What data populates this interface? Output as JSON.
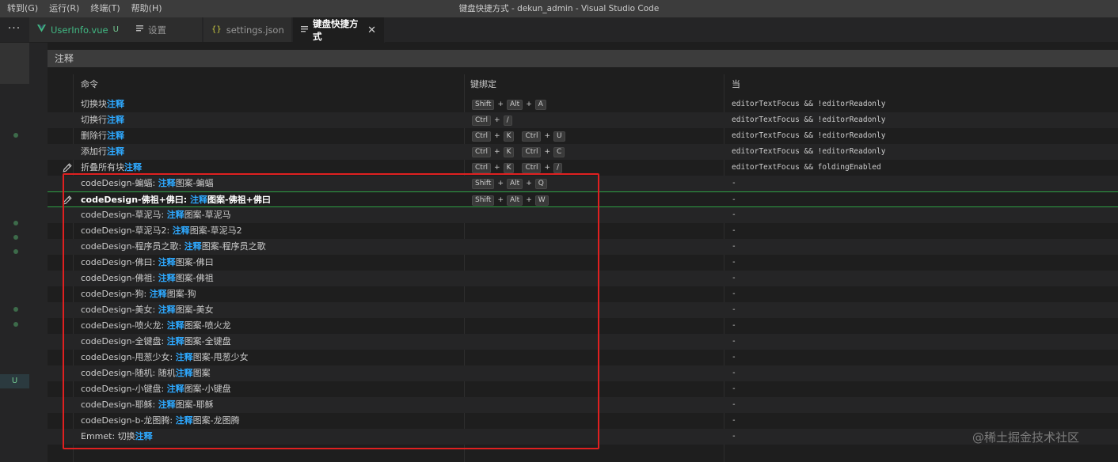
{
  "menu": [
    {
      "label": "转到(G)"
    },
    {
      "label": "运行(R)"
    },
    {
      "label": "终端(T)"
    },
    {
      "label": "帮助(H)"
    }
  ],
  "window_title": "键盘快捷方式 - dekun_admin - Visual Studio Code",
  "tabs": {
    "more": "···",
    "items": [
      {
        "label": "UserInfo.vue",
        "icon": "vue-icon",
        "badge": "U",
        "color": "#41b883"
      },
      {
        "label": "设置",
        "icon": "settings-file-icon"
      },
      {
        "label": "settings.json",
        "icon": "json-braces-icon",
        "icon_text": "{}"
      },
      {
        "label": "键盘快捷方式",
        "icon": "keyboard-file-icon",
        "close": "✕"
      }
    ]
  },
  "gutter": {
    "badge": "U"
  },
  "search": {
    "value": "注释"
  },
  "columns": {
    "command": "命令",
    "keybinding": "键绑定",
    "when": "当"
  },
  "rows": [
    {
      "pre": "切换块",
      "hl": "注释",
      "post": "",
      "keys": [
        [
          "Shift",
          "Alt",
          "A"
        ]
      ],
      "when": "editorTextFocus && !editorReadonly"
    },
    {
      "pre": "切换行",
      "hl": "注释",
      "post": "",
      "keys": [
        [
          "Ctrl",
          "/"
        ]
      ],
      "when": "editorTextFocus && !editorReadonly"
    },
    {
      "pre": "删除行",
      "hl": "注释",
      "post": "",
      "keys": [
        [
          "Ctrl",
          "K"
        ],
        [
          "Ctrl",
          "U"
        ]
      ],
      "when": "editorTextFocus && !editorReadonly"
    },
    {
      "pre": "添加行",
      "hl": "注释",
      "post": "",
      "keys": [
        [
          "Ctrl",
          "K"
        ],
        [
          "Ctrl",
          "C"
        ]
      ],
      "when": "editorTextFocus && !editorReadonly"
    },
    {
      "pre": "折叠所有块",
      "hl": "注释",
      "post": "",
      "keys": [
        [
          "Ctrl",
          "K"
        ],
        [
          "Ctrl",
          "/"
        ]
      ],
      "when": "editorTextFocus && foldingEnabled",
      "pencil": true
    },
    {
      "pre": "codeDesign-蝙蝠: ",
      "hl": "注释",
      "post": "图案-蝙蝠",
      "keys": [
        [
          "Shift",
          "Alt",
          "Q"
        ]
      ],
      "when": "-"
    },
    {
      "pre": "codeDesign-佛祖+佛曰: ",
      "hl": "注释",
      "post": "图案-佛祖+佛曰",
      "keys": [
        [
          "Shift",
          "Alt",
          "W"
        ]
      ],
      "when": "-",
      "pencil": true,
      "focused": true
    },
    {
      "pre": "codeDesign-草泥马: ",
      "hl": "注释",
      "post": "图案-草泥马",
      "keys": [],
      "when": "-"
    },
    {
      "pre": "codeDesign-草泥马2: ",
      "hl": "注释",
      "post": "图案-草泥马2",
      "keys": [],
      "when": "-"
    },
    {
      "pre": "codeDesign-程序员之歌: ",
      "hl": "注释",
      "post": "图案-程序员之歌",
      "keys": [],
      "when": "-"
    },
    {
      "pre": "codeDesign-佛曰: ",
      "hl": "注释",
      "post": "图案-佛曰",
      "keys": [],
      "when": "-"
    },
    {
      "pre": "codeDesign-佛祖: ",
      "hl": "注释",
      "post": "图案-佛祖",
      "keys": [],
      "when": "-"
    },
    {
      "pre": "codeDesign-狗: ",
      "hl": "注释",
      "post": "图案-狗",
      "keys": [],
      "when": "-"
    },
    {
      "pre": "codeDesign-美女: ",
      "hl": "注释",
      "post": "图案-美女",
      "keys": [],
      "when": "-"
    },
    {
      "pre": "codeDesign-喷火龙: ",
      "hl": "注释",
      "post": "图案-喷火龙",
      "keys": [],
      "when": "-"
    },
    {
      "pre": "codeDesign-全键盘: ",
      "hl": "注释",
      "post": "图案-全键盘",
      "keys": [],
      "when": "-"
    },
    {
      "pre": "codeDesign-甩葱少女: ",
      "hl": "注释",
      "post": "图案-甩葱少女",
      "keys": [],
      "when": "-"
    },
    {
      "pre": "codeDesign-随机: 随机",
      "hl": "注释",
      "post": "图案",
      "keys": [],
      "when": "-"
    },
    {
      "pre": "codeDesign-小键盘: ",
      "hl": "注释",
      "post": "图案-小键盘",
      "keys": [],
      "when": "-"
    },
    {
      "pre": "codeDesign-耶稣: ",
      "hl": "注释",
      "post": "图案-耶稣",
      "keys": [],
      "when": "-"
    },
    {
      "pre": "codeDesign-b-龙图腾: ",
      "hl": "注释",
      "post": "图案-龙图腾",
      "keys": [],
      "when": "-"
    },
    {
      "pre": "Emmet: 切换",
      "hl": "注释",
      "post": "",
      "keys": [],
      "when": "-"
    }
  ],
  "watermark": "@稀土掘金技术社区",
  "colors": {
    "accent": "#2ea9ff",
    "annotation": "#e02020",
    "focus": "#2ea043",
    "untracked": "#73c991"
  }
}
